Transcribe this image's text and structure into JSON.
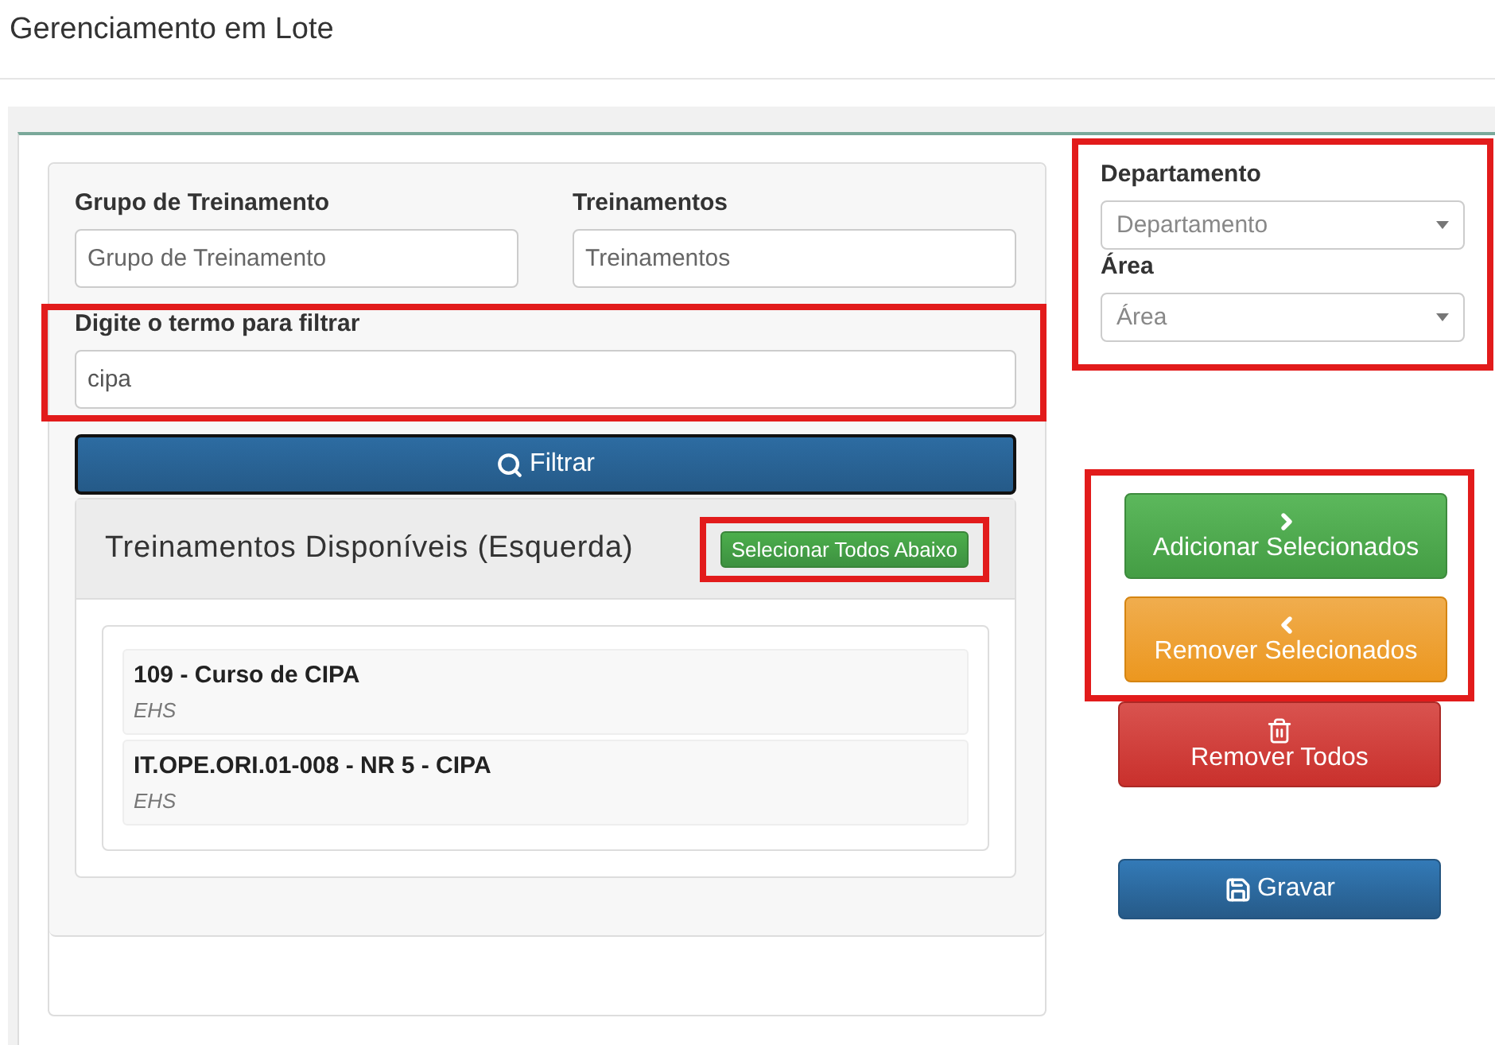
{
  "page_title": "Gerenciamento em Lote",
  "filters": [
    {
      "label": "Grupo de Treinamento",
      "placeholder": "Grupo de Treinamento"
    },
    {
      "label": "Treinamentos",
      "placeholder": "Treinamentos"
    }
  ],
  "search": {
    "label": "Digite o termo para filtrar",
    "value": "cipa",
    "highlighted": true
  },
  "filter_button": "Filtrar",
  "available": {
    "title": "Treinamentos Disponíveis (Esquerda)",
    "select_all": {
      "label": "Selecionar Todos Abaixo",
      "highlighted": true
    },
    "items": [
      {
        "name": "109 - Curso de CIPA",
        "category": "EHS"
      },
      {
        "name": "IT.OPE.ORI.01-008 - NR 5 - CIPA",
        "category": "EHS"
      }
    ]
  },
  "selects": {
    "highlighted": true,
    "fields": [
      {
        "label": "Departamento",
        "placeholder": "Departamento"
      },
      {
        "label": "Área",
        "placeholder": "Área"
      }
    ]
  },
  "actions": {
    "highlighted": true,
    "buttons": [
      {
        "kind": "add",
        "label": "Adicionar Selecionados"
      },
      {
        "kind": "remove",
        "label": "Remover Selecionados"
      }
    ]
  },
  "remove_all": "Remover Todos",
  "save": "Gravar"
}
